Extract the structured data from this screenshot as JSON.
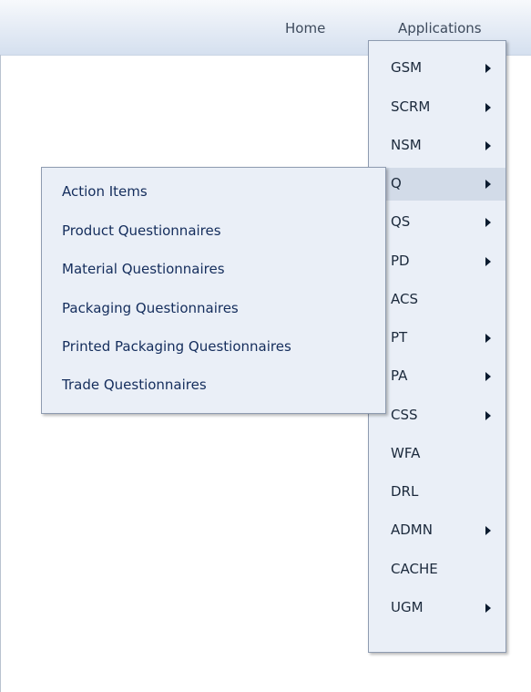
{
  "topnav": {
    "home": "Home",
    "applications": "Applications"
  },
  "apps_menu": {
    "items": [
      {
        "label": "GSM",
        "has_submenu": true
      },
      {
        "label": "SCRM",
        "has_submenu": true
      },
      {
        "label": "NSM",
        "has_submenu": true
      },
      {
        "label": "Q",
        "has_submenu": true,
        "highlighted": true
      },
      {
        "label": "QS",
        "has_submenu": true
      },
      {
        "label": "PD",
        "has_submenu": true
      },
      {
        "label": "ACS",
        "has_submenu": false
      },
      {
        "label": "PT",
        "has_submenu": true
      },
      {
        "label": "PA",
        "has_submenu": true
      },
      {
        "label": "CSS",
        "has_submenu": true
      },
      {
        "label": "WFA",
        "has_submenu": false
      },
      {
        "label": "DRL",
        "has_submenu": false
      },
      {
        "label": "ADMN",
        "has_submenu": true
      },
      {
        "label": "CACHE",
        "has_submenu": false
      },
      {
        "label": "UGM",
        "has_submenu": true
      }
    ]
  },
  "submenu": {
    "items": [
      {
        "label": "Action Items"
      },
      {
        "label": "Product Questionnaires"
      },
      {
        "label": "Material Questionnaires"
      },
      {
        "label": "Packaging Questionnaires"
      },
      {
        "label": "Printed Packaging Questionnaires"
      },
      {
        "label": "Trade Questionnaires"
      }
    ]
  },
  "colors": {
    "menu_background": "#eaeff7",
    "menu_border": "#8e9bb0",
    "highlight": "#d2dbe8",
    "submenu_text": "#142d5c",
    "nav_text": "#3d4a5c"
  }
}
